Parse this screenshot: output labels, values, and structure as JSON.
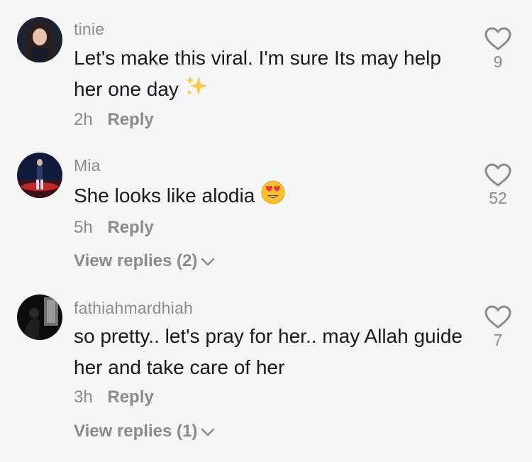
{
  "comments": [
    {
      "username": "tinie",
      "text": "Let's make this viral. I'm sure Its may help her one day",
      "emoji": "sparkles-emoji",
      "time": "2h",
      "reply_label": "Reply",
      "likes": "9"
    },
    {
      "username": "Mia",
      "text": "She looks like alodia",
      "emoji": "heart-eyes-emoji",
      "time": "5h",
      "reply_label": "Reply",
      "likes": "52",
      "view_replies": "View replies (2)"
    },
    {
      "username": "fathiahmardhiah",
      "text": "so pretty.. let's pray for her.. may Allah guide her and take care of her",
      "time": "3h",
      "reply_label": "Reply",
      "likes": "7",
      "view_replies": "View replies (1)"
    }
  ],
  "colors": {
    "background": "#f5f5f5",
    "text_primary": "#161823",
    "text_secondary": "#8a8b91"
  },
  "icons": [
    "heart-outline-icon",
    "chevron-down-icon"
  ]
}
